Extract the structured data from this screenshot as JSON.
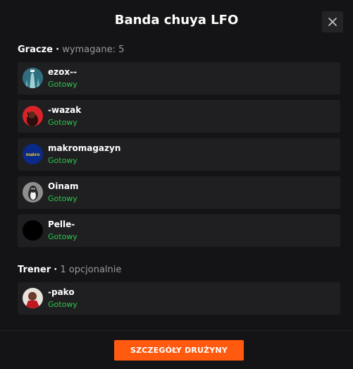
{
  "title": "Banda chuya LFO",
  "players_section": {
    "label": "Gracze",
    "separator": "·",
    "note": "wymagane: 5",
    "items": [
      {
        "name": "ezox--",
        "status": "Gotowy",
        "avatar": "avatar-ezox-icon"
      },
      {
        "name": "-wazak",
        "status": "Gotowy",
        "avatar": "avatar-wazak-icon"
      },
      {
        "name": "makromagazyn",
        "status": "Gotowy",
        "avatar": "avatar-makro-icon",
        "avatar_text": "makro"
      },
      {
        "name": "Oinam",
        "status": "Gotowy",
        "avatar": "avatar-oinam-icon"
      },
      {
        "name": "Pelle-",
        "status": "Gotowy",
        "avatar": "avatar-pelle-icon"
      }
    ]
  },
  "coach_section": {
    "label": "Trener",
    "separator": "·",
    "note": "1 opcjonalnie",
    "items": [
      {
        "name": "-pako",
        "status": "Gotowy",
        "avatar": "avatar-pako-icon"
      }
    ]
  },
  "details_button": "SZCZEGÓŁY DRUŻYNY",
  "colors": {
    "accent": "#ff5a0f",
    "ready": "#2fc44a",
    "card": "#1f1f22",
    "background": "#141416"
  }
}
